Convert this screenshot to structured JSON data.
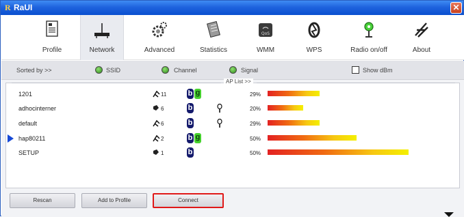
{
  "window": {
    "title": "RaUI",
    "logo_letter": "R",
    "close_glyph": "✕"
  },
  "toolbar": {
    "items": [
      {
        "label": "Profile",
        "icon": "profile-icon"
      },
      {
        "label": "Network",
        "icon": "network-icon",
        "active": true
      },
      {
        "label": "Advanced",
        "icon": "advanced-gear-icon"
      },
      {
        "label": "Statistics",
        "icon": "statistics-icon"
      },
      {
        "label": "WMM",
        "icon": "wmm-qos-icon"
      },
      {
        "label": "WPS",
        "icon": "wps-icon"
      },
      {
        "label": "Radio on/off",
        "icon": "radio-on-icon"
      },
      {
        "label": "About",
        "icon": "about-icon"
      }
    ]
  },
  "sort": {
    "label": "Sorted by >>",
    "options": [
      "SSID",
      "Channel",
      "Signal"
    ],
    "show_dbm_label": "Show dBm"
  },
  "ap_list": {
    "title": "AP List >>",
    "rows": [
      {
        "ssid": "1201",
        "channel": "11",
        "modes": [
          "b",
          "g"
        ],
        "locked": false,
        "signal": "29%",
        "signal_value": 29,
        "selected": false
      },
      {
        "ssid": "adhocinterner",
        "channel": "6",
        "modes": [
          "b"
        ],
        "locked": true,
        "signal": "20%",
        "signal_value": 20,
        "selected": false
      },
      {
        "ssid": "default",
        "channel": "6",
        "modes": [
          "b"
        ],
        "locked": true,
        "signal": "29%",
        "signal_value": 29,
        "selected": false
      },
      {
        "ssid": "hap80211",
        "channel": "2",
        "modes": [
          "b",
          "g"
        ],
        "locked": false,
        "signal": "50%",
        "signal_value": 50,
        "selected": true
      },
      {
        "ssid": "SETUP",
        "channel": "1",
        "modes": [
          "b"
        ],
        "locked": false,
        "signal": "50%",
        "signal_value": 50,
        "selected": false
      }
    ]
  },
  "buttons": {
    "rescan": "Rescan",
    "add_to_profile": "Add to Profile",
    "connect": "Connect"
  },
  "colors": {
    "title_bar": "#1f63de",
    "highlight_border": "#e01818",
    "selected_arrow": "#1749d6"
  }
}
